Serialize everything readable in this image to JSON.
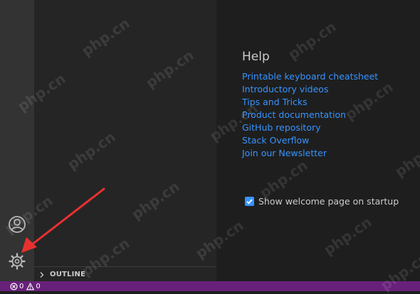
{
  "sidebar": {
    "outline_label": "OUTLINE"
  },
  "welcome": {
    "help_title": "Help",
    "help_links": [
      "Printable keyboard cheatsheet",
      "Introductory videos",
      "Tips and Tricks",
      "Product documentation",
      "GitHub repository",
      "Stack Overflow",
      "Join our Newsletter"
    ],
    "startup_label": "Show welcome page on startup",
    "startup_checked": true
  },
  "status_bar": {
    "errors": "0",
    "warnings": "0"
  },
  "watermark": {
    "text": "php.cn"
  },
  "colors": {
    "link": "#3794ff",
    "status_bar": "#68217a",
    "arrow": "#e8312f"
  },
  "icons": {
    "account": "account-icon",
    "settings": "gear-icon",
    "error": "error-icon",
    "warning": "warning-icon",
    "chevron": "chevron-right-icon"
  }
}
